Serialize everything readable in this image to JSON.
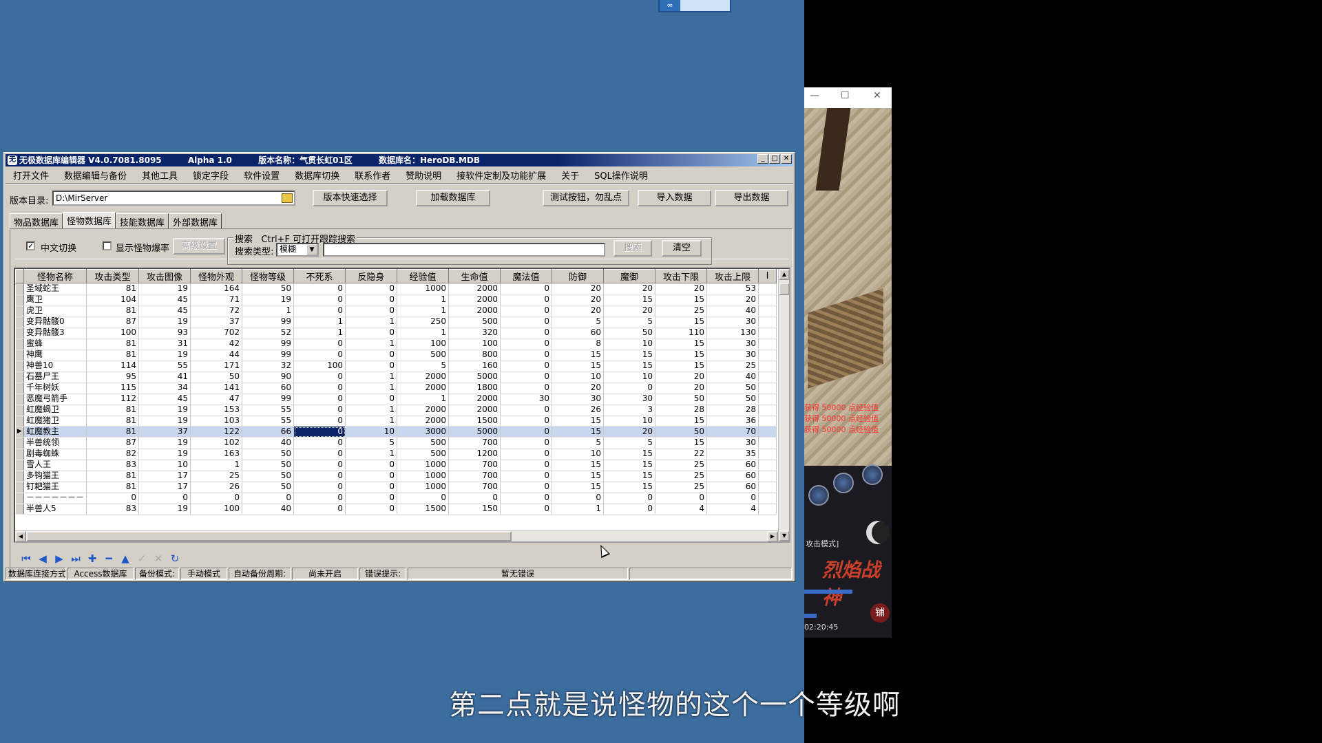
{
  "main_window": {
    "title": {
      "app": "无极数据库编辑器 V4.0.7081.8095",
      "build": "Alpha 1.0",
      "version_name": "版本名称：气贯长虹01区",
      "db_name": "数据库名：HeroDB.MDB"
    },
    "menu": [
      "打开文件",
      "数据编辑与备份",
      "其他工具",
      "锁定字段",
      "软件设置",
      "数据库切换",
      "联系作者",
      "赞助说明",
      "接软件定制及功能扩展",
      "关于",
      "SQL操作说明"
    ],
    "version_dir_label": "版本目录:",
    "version_dir_value": "D:\\MirServer",
    "buttons": {
      "quick_select": "版本快速选择",
      "load_db": "加载数据库",
      "test_button": "测试按钮，勿乱点",
      "import": "导入数据",
      "export": "导出数据"
    },
    "tabs": [
      "物品数据库",
      "怪物数据库",
      "技能数据库",
      "外部数据库"
    ],
    "active_tab": "怪物数据库",
    "options": {
      "chinese_switch": "中文切换",
      "chinese_switch_checked": true,
      "show_drop_rate": "显示怪物爆率",
      "show_drop_rate_checked": false,
      "advanced": "高级设置"
    },
    "search": {
      "group_label": "搜索",
      "hint": "Ctrl+F 可打开跟踪搜索",
      "type_label": "搜索类型:",
      "type_value": "模糊",
      "query_value": "",
      "search_button": "搜索",
      "clear_button": "清空"
    },
    "table": {
      "columns": [
        "怪物名称",
        "攻击类型",
        "攻击图像",
        "怪物外观",
        "怪物等级",
        "不死系",
        "反隐身",
        "经验值",
        "生命值",
        "魔法值",
        "防御",
        "魔御",
        "攻击下限",
        "攻击上限",
        "Ⅰ"
      ],
      "selected_row_index": 13,
      "rows": [
        [
          "圣域蛇王",
          "81",
          "19",
          "164",
          "50",
          "0",
          "0",
          "1000",
          "2000",
          "0",
          "20",
          "20",
          "20",
          "53"
        ],
        [
          "鹰卫",
          "104",
          "45",
          "71",
          "19",
          "0",
          "0",
          "1",
          "2000",
          "0",
          "20",
          "15",
          "15",
          "20"
        ],
        [
          "虎卫",
          "81",
          "45",
          "72",
          "1",
          "0",
          "0",
          "1",
          "2000",
          "0",
          "20",
          "20",
          "25",
          "40"
        ],
        [
          "变异骷髅0",
          "87",
          "19",
          "37",
          "99",
          "1",
          "1",
          "250",
          "500",
          "0",
          "5",
          "5",
          "15",
          "30"
        ],
        [
          "变异骷髅3",
          "100",
          "93",
          "702",
          "52",
          "1",
          "0",
          "1",
          "320",
          "0",
          "60",
          "50",
          "110",
          "130"
        ],
        [
          "蜜蜂",
          "81",
          "31",
          "42",
          "99",
          "0",
          "1",
          "100",
          "100",
          "0",
          "8",
          "10",
          "15",
          "30"
        ],
        [
          "神鹰",
          "81",
          "19",
          "44",
          "99",
          "0",
          "0",
          "500",
          "800",
          "0",
          "15",
          "15",
          "15",
          "30"
        ],
        [
          "神兽10",
          "114",
          "55",
          "171",
          "32",
          "100",
          "0",
          "5",
          "160",
          "0",
          "15",
          "15",
          "15",
          "25"
        ],
        [
          "石墓尸王",
          "95",
          "41",
          "50",
          "90",
          "0",
          "1",
          "2000",
          "5000",
          "0",
          "10",
          "10",
          "20",
          "40"
        ],
        [
          "千年树妖",
          "115",
          "34",
          "141",
          "60",
          "0",
          "1",
          "2000",
          "1800",
          "0",
          "20",
          "0",
          "20",
          "50"
        ],
        [
          "恶魔弓箭手",
          "112",
          "45",
          "47",
          "99",
          "0",
          "0",
          "1",
          "2000",
          "30",
          "30",
          "30",
          "50",
          "50"
        ],
        [
          "虹魔蝎卫",
          "81",
          "19",
          "153",
          "55",
          "0",
          "1",
          "2000",
          "2000",
          "0",
          "26",
          "3",
          "28",
          "28"
        ],
        [
          "虹魔猪卫",
          "81",
          "19",
          "103",
          "55",
          "0",
          "1",
          "2000",
          "1500",
          "0",
          "15",
          "10",
          "15",
          "36"
        ],
        [
          "虹魔教主",
          "81",
          "37",
          "122",
          "66",
          "0",
          "10",
          "3000",
          "5000",
          "0",
          "15",
          "20",
          "50",
          "70"
        ],
        [
          "半兽统领",
          "87",
          "19",
          "102",
          "40",
          "0",
          "5",
          "500",
          "700",
          "0",
          "5",
          "5",
          "15",
          "30"
        ],
        [
          "剧毒蜘蛛",
          "82",
          "19",
          "163",
          "50",
          "0",
          "1",
          "500",
          "1200",
          "0",
          "10",
          "15",
          "22",
          "35"
        ],
        [
          "雪人王",
          "83",
          "10",
          "1",
          "50",
          "0",
          "0",
          "1000",
          "700",
          "0",
          "15",
          "15",
          "25",
          "60"
        ],
        [
          "多钩猫王",
          "81",
          "17",
          "25",
          "50",
          "0",
          "0",
          "1000",
          "700",
          "0",
          "15",
          "15",
          "25",
          "60"
        ],
        [
          "钉耙猫王",
          "81",
          "17",
          "26",
          "50",
          "0",
          "0",
          "1000",
          "700",
          "0",
          "15",
          "15",
          "25",
          "60"
        ],
        [
          "－－－－－－－",
          "0",
          "0",
          "0",
          "0",
          "0",
          "0",
          "0",
          "0",
          "0",
          "0",
          "0",
          "0",
          "0"
        ],
        [
          "半兽人5",
          "83",
          "19",
          "100",
          "40",
          "0",
          "0",
          "1500",
          "150",
          "0",
          "1",
          "0",
          "4",
          "4"
        ]
      ]
    },
    "status": {
      "conn_label": "数据库连接方式:",
      "conn_value": "Access数据库",
      "backup_label": "备份模式:",
      "backup_value": "手动模式",
      "auto_label": "自动备份周期:",
      "auto_value": "尚未开启",
      "error_label": "错误提示:",
      "error_value": "暂无错误"
    }
  },
  "game_window": {
    "red_lines": [
      "获得 50000 点经验值",
      "获得 50000 点经验值",
      "获得 50000 点经验值"
    ],
    "mode_text": "攻击模式]",
    "logo": "烈焰战神",
    "time_text": "02:20:45",
    "shop_button": "铺"
  },
  "subtitle": "第二点就是说怪物的这个一个等级啊"
}
